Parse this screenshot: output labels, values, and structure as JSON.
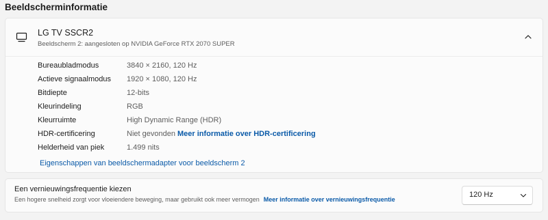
{
  "section": {
    "title": "Beeldscherminformatie"
  },
  "display": {
    "name": "LG TV SSCR2",
    "subtitle": "Beeldscherm 2: aangesloten op NVIDIA GeForce RTX 2070 SUPER",
    "icon": "monitor-icon",
    "expanded": true,
    "collapse_icon": "chevron-up-icon",
    "info": [
      {
        "label": "Bureaubladmodus",
        "value": "3840 × 2160, 120 Hz"
      },
      {
        "label": "Actieve signaalmodus",
        "value": "1920 × 1080, 120 Hz"
      },
      {
        "label": "Bitdiepte",
        "value": "12-bits"
      },
      {
        "label": "Kleurindeling",
        "value": "RGB"
      },
      {
        "label": "Kleurruimte",
        "value": "High Dynamic Range (HDR)"
      },
      {
        "label": "HDR-certificering",
        "value": "Niet gevonden",
        "link": "Meer informatie over HDR-certificering"
      },
      {
        "label": "Helderheid van piek",
        "value": "1.499 nits"
      }
    ],
    "adapter_link": "Eigenschappen van beeldschermadapter voor beeldscherm 2"
  },
  "refresh": {
    "title": "Een vernieuwingsfrequentie kiezen",
    "description": "Een hogere snelheid zorgt voor vloeiendere beweging, maar gebruikt ook meer vermogen",
    "link": "Meer informatie over vernieuwingsfrequentie",
    "selected": "120 Hz",
    "dropdown_icon": "chevron-down-icon"
  },
  "colors": {
    "background": "#f3f3f3",
    "card": "#fbfbfb",
    "link": "#0a5aa8",
    "text_primary": "#1b1b1b",
    "text_secondary": "#5d5d5d"
  }
}
